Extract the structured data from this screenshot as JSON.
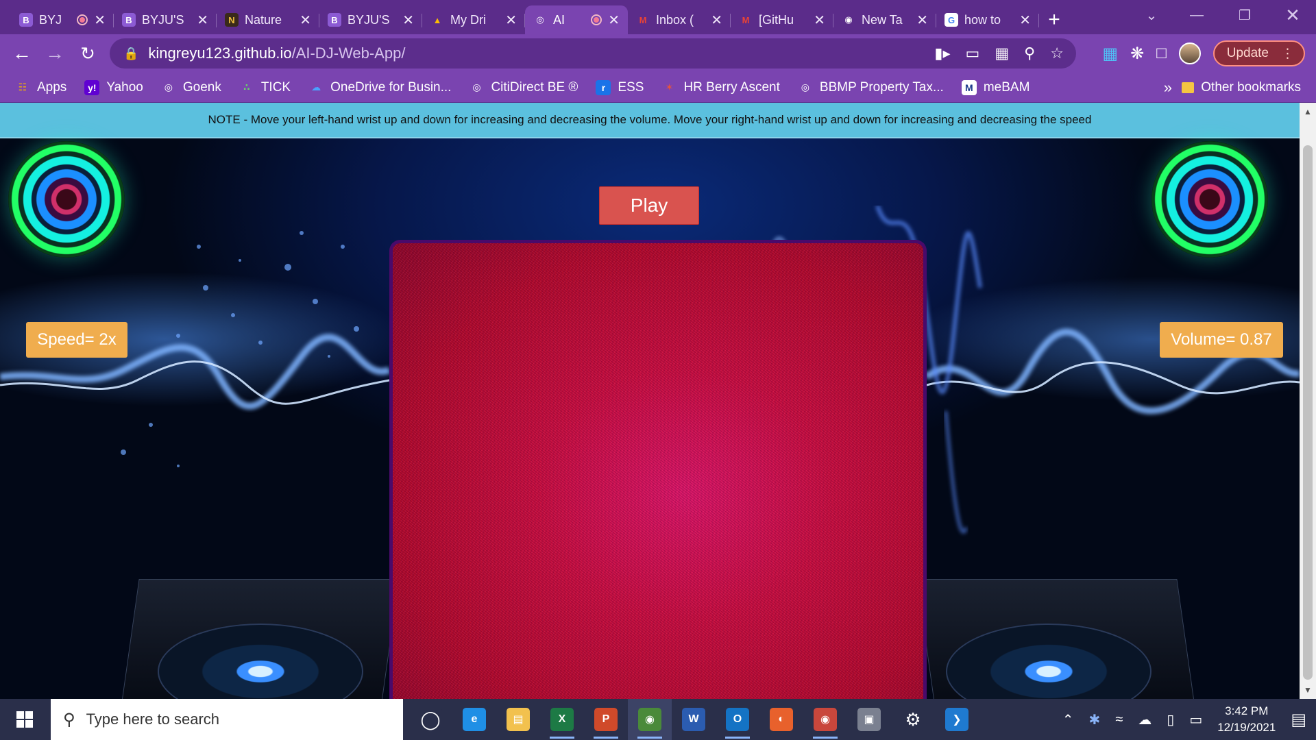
{
  "browser": {
    "tabs": [
      {
        "title": "BYJ",
        "icon": "byjus-icon",
        "recording": true,
        "active": false
      },
      {
        "title": "BYJU'S",
        "icon": "byjus-icon",
        "recording": false,
        "active": false
      },
      {
        "title": "Nature",
        "icon": "nature-icon",
        "recording": false,
        "active": false
      },
      {
        "title": "BYJU'S",
        "icon": "byjus-icon",
        "recording": false,
        "active": false
      },
      {
        "title": "My Dri",
        "icon": "drive-icon",
        "recording": false,
        "active": false
      },
      {
        "title": "AI",
        "icon": "globe-icon",
        "recording": true,
        "active": true
      },
      {
        "title": "Inbox (",
        "icon": "gmail-icon",
        "recording": false,
        "active": false
      },
      {
        "title": "[GitHu",
        "icon": "gmail-icon",
        "recording": false,
        "active": false
      },
      {
        "title": "New Ta",
        "icon": "chrome-icon",
        "recording": false,
        "active": false
      },
      {
        "title": "how to",
        "icon": "google-icon",
        "recording": false,
        "active": false
      }
    ],
    "url_host": "kingreyu123.github.io",
    "url_path": "/AI-DJ-Web-App/",
    "update_label": "Update",
    "bookmarks": [
      {
        "label": "Apps",
        "icon": "apps-grid-icon"
      },
      {
        "label": "Yahoo",
        "icon": "yahoo-icon"
      },
      {
        "label": "Goenk",
        "icon": "globe-icon"
      },
      {
        "label": "TICK",
        "icon": "tick-icon"
      },
      {
        "label": "OneDrive for Busin...",
        "icon": "onedrive-icon"
      },
      {
        "label": "CitiDirect BE ®",
        "icon": "globe-icon"
      },
      {
        "label": "ESS",
        "icon": "ess-icon"
      },
      {
        "label": "HR Berry Ascent",
        "icon": "hr-icon"
      },
      {
        "label": "BBMP Property Tax...",
        "icon": "globe-icon"
      },
      {
        "label": "meBAM",
        "icon": "mebam-icon"
      }
    ],
    "bookmarks_more": "»",
    "other_bookmarks": "Other bookmarks"
  },
  "page": {
    "note": "NOTE - Move your left-hand wrist up and down for increasing and decreasing the volume. Move your right-hand wrist up and down for increasing and decreasing the speed",
    "play_label": "Play",
    "speed_label": "Speed= 2x",
    "volume_label": "Volume= 0.87"
  },
  "taskbar": {
    "search_placeholder": "Type here to search",
    "apps": [
      {
        "name": "cortana",
        "icon": "cortana-icon",
        "color": "#2a2f4a",
        "running": false,
        "active": false
      },
      {
        "name": "edge",
        "icon": "edge-icon",
        "color": "#1f8fe5",
        "running": false,
        "active": false
      },
      {
        "name": "file-explorer",
        "icon": "folder-icon",
        "color": "#f2c14e",
        "running": false,
        "active": false
      },
      {
        "name": "excel",
        "icon": "excel-icon",
        "color": "#1d7a45",
        "running": true,
        "active": false
      },
      {
        "name": "powerpoint",
        "icon": "powerpoint-icon",
        "color": "#d04a2a",
        "running": true,
        "active": false
      },
      {
        "name": "chrome",
        "icon": "chrome-icon",
        "color": "#4a8a3a",
        "running": true,
        "active": true
      },
      {
        "name": "word",
        "icon": "word-icon",
        "color": "#2b5cb0",
        "running": false,
        "active": false
      },
      {
        "name": "outlook",
        "icon": "outlook-icon",
        "color": "#1473c4",
        "running": true,
        "active": false
      },
      {
        "name": "firefox",
        "icon": "firefox-icon",
        "color": "#e8612c",
        "running": false,
        "active": false
      },
      {
        "name": "chrome-profile",
        "icon": "chrome-icon",
        "color": "#c9473c",
        "running": true,
        "active": false
      },
      {
        "name": "camera",
        "icon": "camera-icon",
        "color": "#7a8090",
        "running": false,
        "active": false
      },
      {
        "name": "settings",
        "icon": "gear-icon",
        "color": "#2a2f4a",
        "running": false,
        "active": false
      },
      {
        "name": "vscode",
        "icon": "vscode-icon",
        "color": "#1f7ad0",
        "running": false,
        "active": false
      }
    ],
    "time": "3:42 PM",
    "date": "12/19/2021"
  },
  "colors": {
    "tab_strip": "#5b2c8a",
    "toolbar": "#7a44b0",
    "note_bg": "#5bc0de",
    "play_button": "#d9534f",
    "badge": "#f0ad4e",
    "canvas_red": "#cc1040"
  }
}
